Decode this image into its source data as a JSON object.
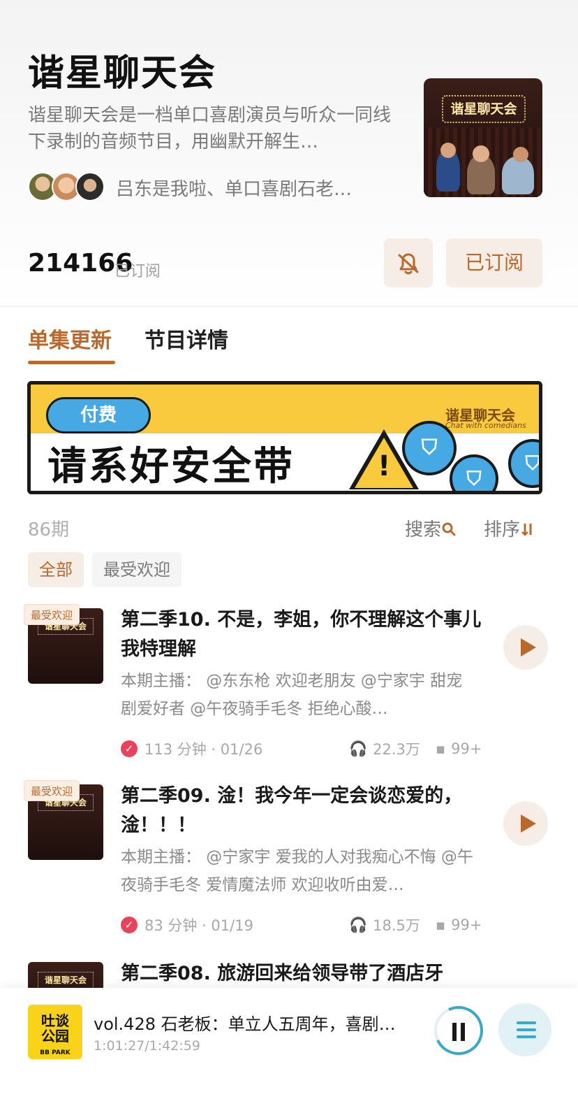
{
  "podcast": {
    "title": "谐星聊天会",
    "description": "谐星聊天会是一档单口喜剧演员与听众一同线下录制的音频节目，用幽默开解生…",
    "hosts": "吕东是我啦、单口喜剧石老…",
    "cover_text": "谐星聊天会",
    "subscriber_count": "214166",
    "subscriber_label": "已订阅",
    "subscribe_button": "已订阅"
  },
  "tabs": [
    {
      "label": "单集更新",
      "active": true
    },
    {
      "label": "节目详情",
      "active": false
    }
  ],
  "banner": {
    "pill": "付费",
    "headline": "请系好安全带",
    "logo": "谐星聊天会",
    "logo_sub": "Chat with comedians",
    "warning_mark": "!"
  },
  "list_header": {
    "episode_count": "86期",
    "search_label": "搜索",
    "sort_label": "排序"
  },
  "filters": [
    {
      "label": "全部",
      "active": true
    },
    {
      "label": "最受欢迎",
      "active": false
    }
  ],
  "episodes": [
    {
      "badge": "最受欢迎",
      "thumb_text": "谐星聊天会",
      "title": "第二季10. 不是，李姐，你不理解这个事儿我特理解",
      "hosts": "本期主播： @东东枪 欢迎老朋友 @宁家宇 甜宠剧爱好者 @午夜骑手毛冬 拒绝心酸…",
      "meta": "113 分钟 · 01/26",
      "plays": "22.3万",
      "comments": "99+"
    },
    {
      "badge": "最受欢迎",
      "thumb_text": "谐星聊天会",
      "title": "第二季09. 淦！我今年一定会谈恋爱的，淦！！！",
      "hosts": "本期主播： @宁家宇 爱我的人对我痴心不悔 @午夜骑手毛冬 爱情魔法师 欢迎收听由爱…",
      "meta": "83 分钟 · 01/19",
      "plays": "18.5万",
      "comments": "99+"
    },
    {
      "badge": "",
      "thumb_text": "谐星聊天会",
      "title": "第二季08. 旅游回来给领导带了酒店牙",
      "hosts": "",
      "meta": "",
      "plays": "",
      "comments": ""
    }
  ],
  "player": {
    "cover_line1": "吐谈",
    "cover_line2": "公园",
    "cover_sub": "BB PARK",
    "title": "vol.428 石老板：单立人五周年，喜剧…",
    "time": "1:01:27/1:42:59",
    "progress": 0.6
  },
  "colors": {
    "accent": "#b8692e",
    "accent_bg": "#f6ede6",
    "banner_yellow": "#f9c93e",
    "banner_blue": "#46a9e4",
    "check_red": "#e8435a",
    "player_blue": "#3aa8c9"
  },
  "icons": {
    "bell": "bell-slash-icon",
    "search": "search-icon",
    "sort": "sort-icon",
    "check": "check-circle-icon",
    "headphones": "headphones-icon",
    "comment": "comment-icon",
    "play": "play-icon",
    "pause": "pause-icon",
    "playlist": "playlist-icon"
  }
}
